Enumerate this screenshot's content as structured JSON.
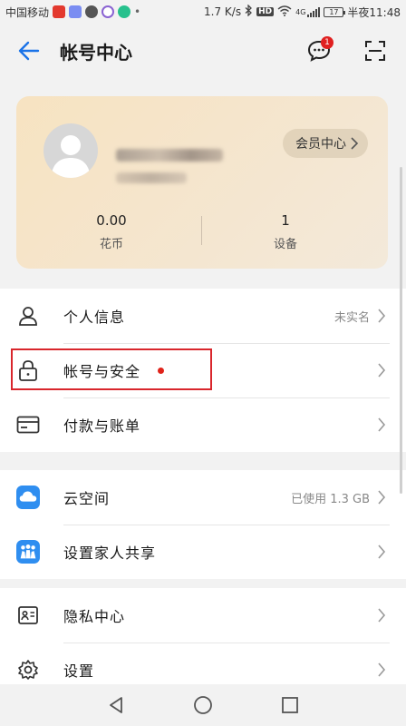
{
  "status_bar": {
    "carrier": "中国移动",
    "speed": "1.7 K/s",
    "hd": "HD",
    "network": "4G",
    "battery": "17",
    "time": "半夜11:48"
  },
  "header": {
    "title": "帐号中心",
    "message_badge": "1"
  },
  "card": {
    "vip_button": "会员中心",
    "stats": [
      {
        "value": "0.00",
        "label": "花币"
      },
      {
        "value": "1",
        "label": "设备"
      }
    ]
  },
  "groups": [
    {
      "items": [
        {
          "label": "个人信息",
          "value": "未实名",
          "icon": "person-icon"
        },
        {
          "label": "帐号与安全",
          "value": "",
          "icon": "lock-icon"
        },
        {
          "label": "付款与账单",
          "value": "",
          "icon": "card-icon"
        }
      ]
    },
    {
      "items": [
        {
          "label": "云空间",
          "value": "已使用 1.3 GB",
          "icon": "cloud-icon"
        },
        {
          "label": "设置家人共享",
          "value": "",
          "icon": "family-icon"
        }
      ]
    },
    {
      "items": [
        {
          "label": "隐私中心",
          "value": "",
          "icon": "privacy-icon"
        },
        {
          "label": "设置",
          "value": "",
          "icon": "settings-icon"
        }
      ]
    }
  ],
  "colors": {
    "accent_blue": "#1a73e8",
    "red_dot": "#e0231a",
    "highlight_border": "#d9262c",
    "card_gold": "#f7e3c1"
  }
}
